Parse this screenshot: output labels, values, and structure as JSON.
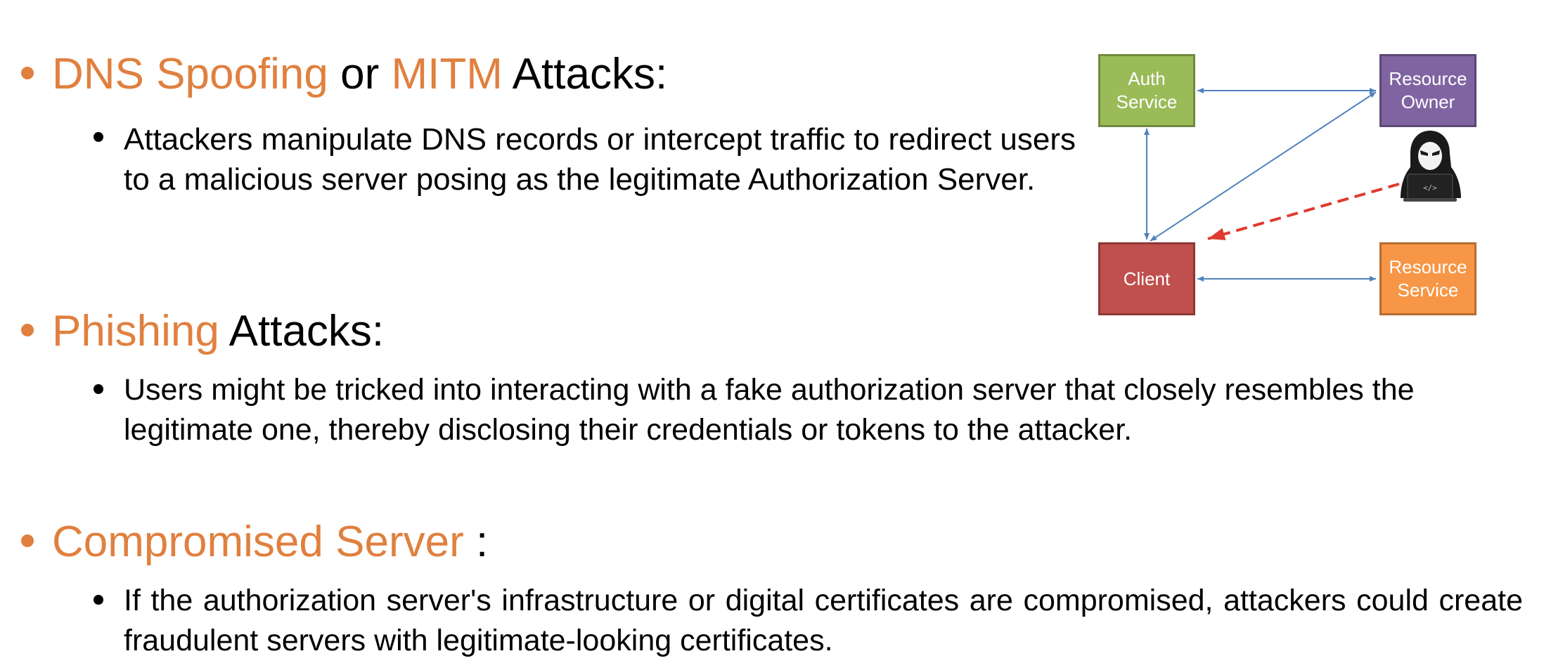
{
  "sections": [
    {
      "heading_parts": [
        {
          "text": "DNS Spoofing",
          "color": "#E0803F"
        },
        {
          "text": " or ",
          "color": "#000000"
        },
        {
          "text": "MITM",
          "color": "#E0803F"
        },
        {
          "text": " Attacks:",
          "color": "#000000"
        }
      ],
      "bullet": "Attackers manipulate DNS records or intercept traffic to redirect users to a malicious server posing as the legitimate Authorization Server."
    },
    {
      "heading_parts": [
        {
          "text": "Phishing",
          "color": "#E0803F"
        },
        {
          "text": " Attacks:",
          "color": "#000000"
        }
      ],
      "bullet": "Users might be tricked into interacting with a fake authorization server that closely resembles the legitimate one, thereby disclosing their credentials or tokens to the attacker."
    },
    {
      "heading_parts": [
        {
          "text": "Compromised Server",
          "color": "#E0803F"
        },
        {
          "text": " :",
          "color": "#000000"
        }
      ],
      "bullet": "If the authorization server's infrastructure or digital certificates are compromised, attackers could create fraudulent servers with legitimate-looking certificates."
    }
  ],
  "diagram": {
    "auth_service": {
      "line1": "Auth",
      "line2": "Service",
      "color": "#9BBB59"
    },
    "resource_owner": {
      "line1": "Resource",
      "line2": "Owner",
      "color": "#8064A2"
    },
    "client": {
      "line1": "Client",
      "color": "#C0504D"
    },
    "resource_service": {
      "line1": "Resource",
      "line2": "Service",
      "color": "#F79646"
    },
    "attacker_icon": "hacker-icon",
    "attacker_screen_text": "</>",
    "arrow_color": "#4F81BD",
    "attack_arrow_color": "#E03A2F"
  }
}
